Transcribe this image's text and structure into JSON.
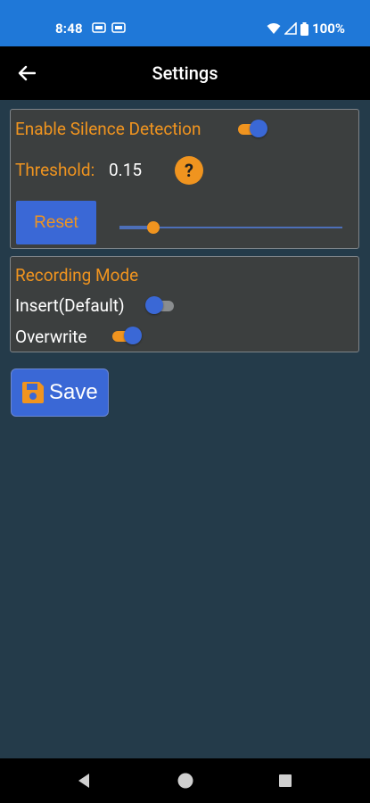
{
  "status_bar": {
    "time": "8:48",
    "battery": "100%"
  },
  "app_bar": {
    "title": "Settings"
  },
  "silence_panel": {
    "enable_label": "Enable Silence Detection",
    "enable_on": true,
    "threshold_label": "Threshold:",
    "threshold_value": "0.15",
    "help_symbol": "?",
    "reset_label": "Reset",
    "slider_fraction": 0.15
  },
  "recording_panel": {
    "title": "Recording Mode",
    "insert_label": "Insert(Default)",
    "insert_on": false,
    "overwrite_label": "Overwrite",
    "overwrite_on": true
  },
  "save_label": "Save",
  "colors": {
    "status_bar": "#1f78d8",
    "background": "#243b4a",
    "panel": "#3c3f3f",
    "accent_orange": "#f0941f",
    "accent_blue": "#3a68d6"
  },
  "icons": {
    "back": "arrow-left-icon",
    "help": "question-circle-icon",
    "save": "floppy-disk-icon",
    "nav_back": "triangle-back-icon",
    "nav_home": "circle-home-icon",
    "nav_recents": "square-recents-icon"
  }
}
